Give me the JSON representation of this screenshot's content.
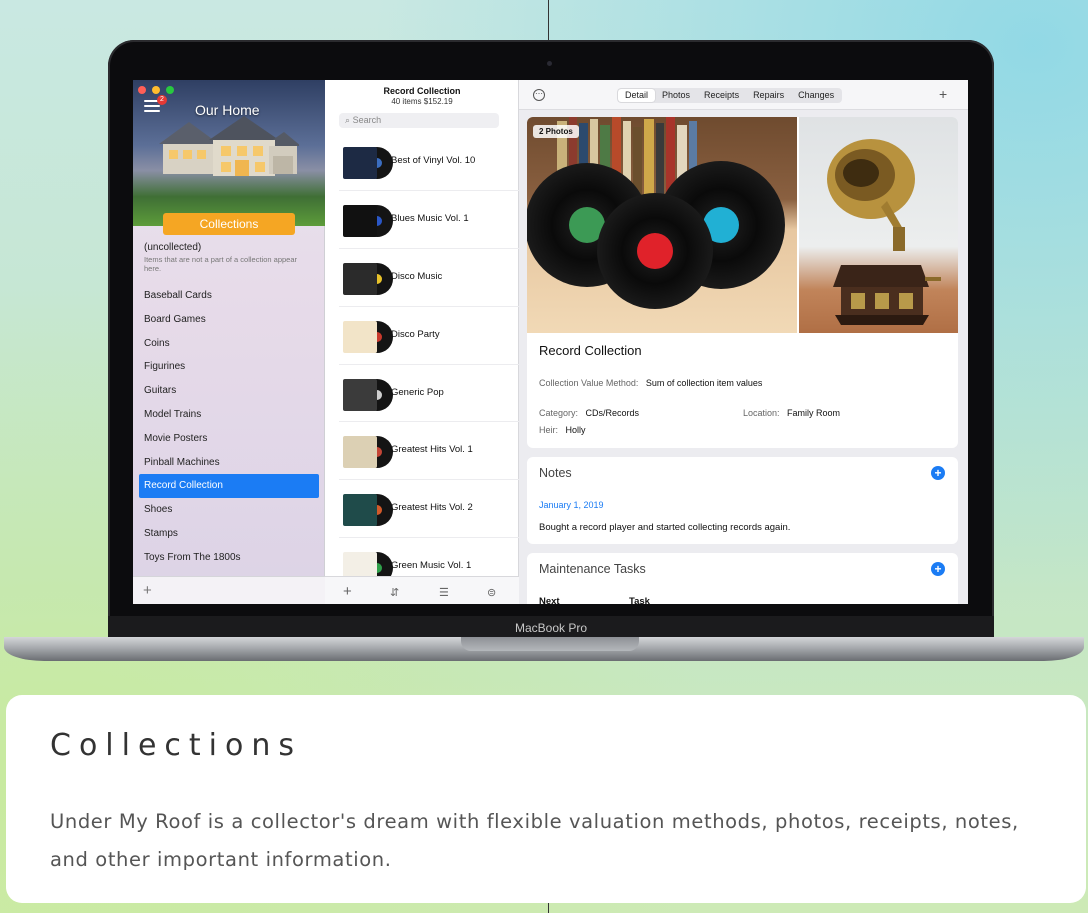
{
  "laptop": {
    "brand_label": "MacBook Pro"
  },
  "sidebar": {
    "title": "Our Home",
    "menu_badge": "2",
    "collections_tab": "Collections",
    "uncollected_title": "(uncollected)",
    "uncollected_desc": "Items that are not a part of a collection appear here.",
    "items": [
      {
        "label": "Baseball Cards"
      },
      {
        "label": "Board Games"
      },
      {
        "label": "Coins"
      },
      {
        "label": "Figurines"
      },
      {
        "label": "Guitars"
      },
      {
        "label": "Model Trains"
      },
      {
        "label": "Movie Posters"
      },
      {
        "label": "Pinball Machines"
      },
      {
        "label": "Record Collection"
      },
      {
        "label": "Shoes"
      },
      {
        "label": "Stamps"
      },
      {
        "label": "Toys From The 1800s"
      }
    ],
    "selected_item": "Record Collection",
    "add_icon": "+"
  },
  "list": {
    "title": "Record Collection",
    "subtitle": "40 items $152.19",
    "search_placeholder": "Search",
    "items": [
      {
        "label": "Best of Vinyl Vol. 10",
        "cover": "#1d2a44",
        "accent": "#3b6dbf"
      },
      {
        "label": "Blues Music Vol. 1",
        "cover": "#111111",
        "accent": "#2a57c7"
      },
      {
        "label": "Disco Music",
        "cover": "#2b2b2b",
        "accent": "#e8c22a"
      },
      {
        "label": "Disco Party",
        "cover": "#f2e4c8",
        "accent": "#c93a2d"
      },
      {
        "label": "Generic Pop",
        "cover": "#3b3b3b",
        "accent": "#cfcfcf"
      },
      {
        "label": "Greatest Hits Vol. 1",
        "cover": "#dcd0b4",
        "accent": "#c44637"
      },
      {
        "label": "Greatest Hits Vol. 2",
        "cover": "#1f4b4a",
        "accent": "#d35a2a"
      },
      {
        "label": "Green Music Vol. 1",
        "cover": "#f3efe6",
        "accent": "#2fa04a"
      }
    ],
    "footer_icons": [
      "plus-icon",
      "sort-icon",
      "filter-list-icon",
      "filter-icon"
    ]
  },
  "detail": {
    "tabs": [
      {
        "label": "Detail",
        "active": true
      },
      {
        "label": "Photos",
        "active": false
      },
      {
        "label": "Receipts",
        "active": false
      },
      {
        "label": "Repairs",
        "active": false
      },
      {
        "label": "Changes",
        "active": false
      }
    ],
    "photo_badge": "2 Photos",
    "title": "Record Collection",
    "value_method_label": "Collection Value Method:",
    "value_method_value": "Sum of collection item values",
    "category_label": "Category:",
    "category_value": "CDs/Records",
    "location_label": "Location:",
    "location_value": "Family Room",
    "heir_label": "Heir:",
    "heir_value": "Holly",
    "notes": {
      "title": "Notes",
      "date": "January 1, 2019",
      "text": "Bought a record player and started collecting records again."
    },
    "maintenance": {
      "title": "Maintenance Tasks",
      "col_next": "Next",
      "col_task": "Task"
    }
  },
  "caption": {
    "title": "Collections",
    "body": "Under My Roof is a collector's dream with flexible valuation methods, photos, receipts, notes, and other important information."
  },
  "colors": {
    "accent": "#1b7cf4",
    "collections_tab": "#f5a623"
  }
}
